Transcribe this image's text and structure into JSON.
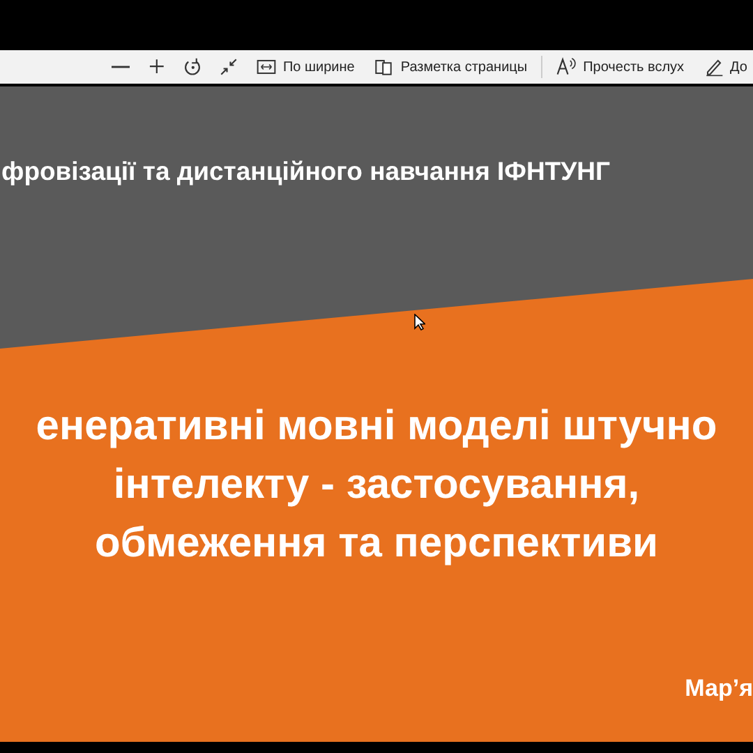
{
  "toolbar": {
    "buttons": [
      {
        "label": "По ширине"
      },
      {
        "label": "Разметка страницы"
      },
      {
        "label": "Прочесть вслух"
      },
      {
        "label": "До"
      }
    ]
  },
  "slide": {
    "header": "фровізації та дистанційного навчання ІФНТУНГ",
    "title_lines": [
      "енеративні мовні моделі штучно",
      "інтелекту - застосування,",
      "обмеження та перспективи"
    ],
    "author": "Мар’я"
  }
}
